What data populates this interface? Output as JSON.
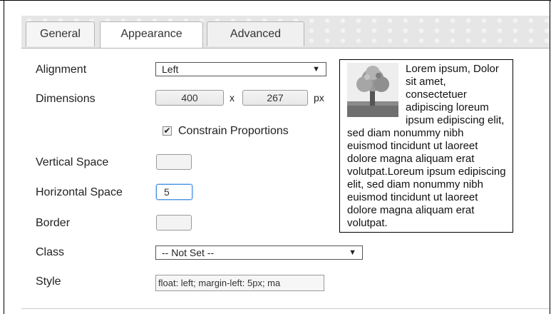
{
  "tabs": [
    {
      "label": "General",
      "active": false
    },
    {
      "label": "Appearance",
      "active": true
    },
    {
      "label": "Advanced",
      "active": false
    }
  ],
  "form": {
    "alignment": {
      "label": "Alignment",
      "value": "Left"
    },
    "dimensions": {
      "label": "Dimensions",
      "width": "400",
      "separator": "x",
      "height": "267",
      "unit": "px"
    },
    "constrain": {
      "label": "Constrain Proportions",
      "checked": true
    },
    "vertical_space": {
      "label": "Vertical Space",
      "value": ""
    },
    "horizontal_space": {
      "label": "Horizontal Space",
      "value": "5"
    },
    "border": {
      "label": "Border",
      "value": ""
    },
    "class_field": {
      "label": "Class",
      "value": "-- Not Set --"
    },
    "style": {
      "label": "Style",
      "value": "float: left; margin-left: 5px; ma"
    }
  },
  "preview": {
    "text": "Lorem ipsum, Dolor sit amet, consectetuer adipiscing loreum ipsum edipiscing elit, sed diam nonummy nibh euismod tincidunt ut laoreet dolore magna aliquam erat volutpat.Loreum ipsum edipiscing elit, sed diam nonummy nibh euismod tincidunt ut laoreet dolore magna aliquam erat volutpat.",
    "image_icon": "tree-image-icon"
  },
  "icons": {
    "dropdown": "▼",
    "check": "✔"
  }
}
